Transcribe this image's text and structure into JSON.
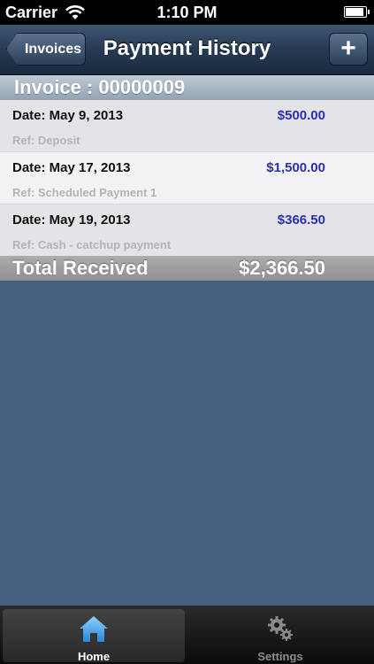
{
  "status_bar": {
    "carrier": "Carrier",
    "time": "1:10 PM"
  },
  "nav": {
    "back_label": "Invoices",
    "title": "Payment History",
    "add_label": "+"
  },
  "invoice_header": "Invoice : 00000009",
  "payments": [
    {
      "date": "Date: May 9, 2013",
      "amount": "$500.00",
      "ref": "Ref: Deposit"
    },
    {
      "date": "Date: May 17, 2013",
      "amount": "$1,500.00",
      "ref": "Ref: Scheduled Payment 1"
    },
    {
      "date": "Date: May 19, 2013",
      "amount": "$366.50",
      "ref": "Ref: Cash - catchup payment"
    }
  ],
  "total": {
    "label": "Total Received",
    "value": "$2,366.50"
  },
  "tabs": [
    {
      "label": "Home",
      "icon": "home-icon",
      "selected": true
    },
    {
      "label": "Settings",
      "icon": "gears-icon",
      "selected": false
    }
  ],
  "colors": {
    "amount": "#2b2fb8",
    "background": "#44607e",
    "selected_tab_icon": "#4aa3ea"
  }
}
